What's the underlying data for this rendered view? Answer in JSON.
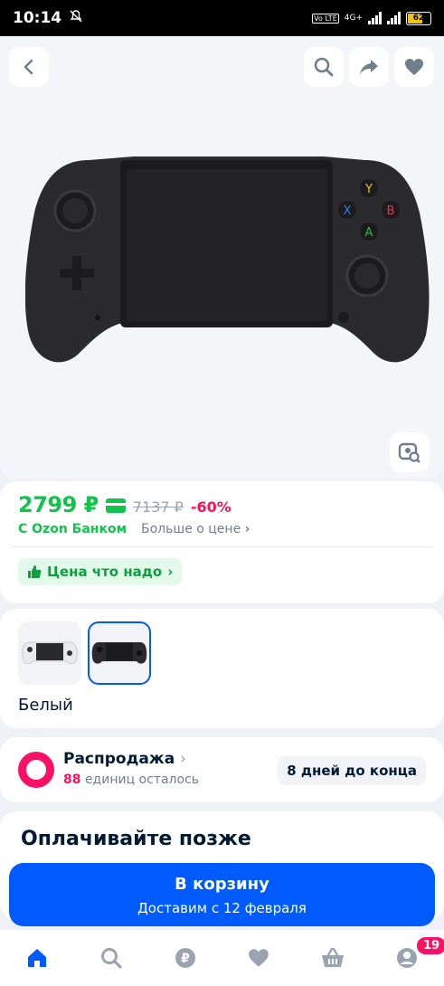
{
  "status_bar": {
    "time": "10:14",
    "network": "4G+",
    "volte": "Vo LTE",
    "battery": "62"
  },
  "product": {
    "price": "2799 ₽",
    "old_price": "7137 ₽",
    "discount": "-60%",
    "bank_label": "С Ozon Банком",
    "more_price_label": "Больше о цене",
    "good_price_label": "Цена что надо"
  },
  "colors": {
    "selected_name": "Белый",
    "options": [
      "white",
      "black"
    ]
  },
  "sale": {
    "title": "Распродажа",
    "remaining_count": "88",
    "remaining_text": "единиц осталось",
    "days_left": "8 дней до конца"
  },
  "pay_later": {
    "title": "Оплачивайте позже"
  },
  "cart_button": {
    "label": "В корзину",
    "delivery": "Доставим с 12 февраля"
  },
  "tabbar": {
    "cart_badge": "19",
    "tabs": [
      "home-icon",
      "search-icon",
      "ruble-icon",
      "heart-icon",
      "basket-icon",
      "profile-icon"
    ]
  },
  "colors_palette": {
    "accent": "#005bff",
    "green": "#10c44c",
    "pink": "#f91166"
  }
}
